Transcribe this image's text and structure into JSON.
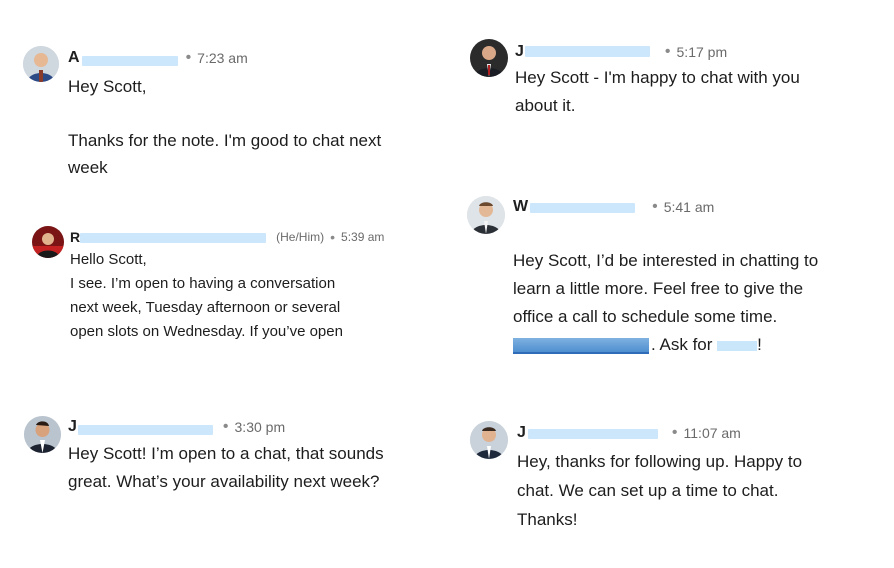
{
  "messages": [
    {
      "name_visible": "A",
      "time": "7:23 am",
      "body": "Hey Scott,\n\nThanks for the note. I'm good to chat next\nweek"
    },
    {
      "name_visible": "R",
      "pronouns": "(He/Him)",
      "time": "5:39 am",
      "body": "Hello Scott,\nI see. I’m open to having a conversation\nnext week, Tuesday afternoon or several\nopen slots on Wednesday. If you’ve open"
    },
    {
      "name_visible": "J",
      "time": "3:30 pm",
      "body": "Hey Scott! I’m open to a chat, that sounds\ngreat. What’s your availability next week?"
    },
    {
      "name_visible": "J",
      "time": "5:17 pm",
      "body": "Hey Scott - I'm happy to chat with you\nabout it."
    },
    {
      "name_visible": "W",
      "time": "5:41 am",
      "body_before": "Hey Scott, I’d be interested in chatting to\nlearn a little more. Feel free to give the\noffice a call to schedule some time.\n",
      "body_mid": ". Ask for ",
      "body_end": "!"
    },
    {
      "name_visible": "J",
      "time": "11:07 am",
      "body": "Hey, thanks for following up. Happy to\nchat. We can set up a time to chat.\nThanks!"
    }
  ],
  "separator": "•"
}
